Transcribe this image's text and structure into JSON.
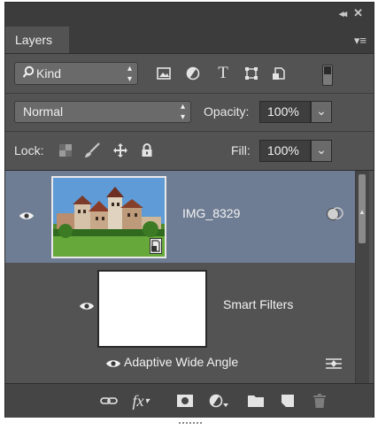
{
  "titlebar": {
    "collapse_glyph": "◂◂",
    "close_glyph": "✕"
  },
  "tab": {
    "label": "Layers"
  },
  "panel_menu_glyph": "▾≡",
  "filter": {
    "kind_label": "Kind",
    "search_glyph": "⚲",
    "buttons": [
      "pixel-layer-filter-icon",
      "adjustment-layer-filter-icon",
      "type-layer-filter-icon",
      "shape-layer-filter-icon",
      "smart-object-filter-icon"
    ],
    "type_glyph": "T"
  },
  "blend": {
    "mode": "Normal",
    "opacity_label": "Opacity:",
    "opacity_value": "100%"
  },
  "lock": {
    "label": "Lock:",
    "fill_label": "Fill:",
    "fill_value": "100%"
  },
  "layers": [
    {
      "name": "IMG_8329",
      "visible": true,
      "selected": true,
      "smart_filters": {
        "label": "Smart Filters",
        "filters": [
          {
            "name": "Adaptive Wide Angle"
          }
        ]
      }
    }
  ],
  "bottom_bar": {
    "fx_label": "fx",
    "buttons": [
      "link-layers-icon",
      "add-layer-style-icon",
      "add-layer-mask-icon",
      "new-adjustment-layer-icon",
      "new-group-icon",
      "new-layer-icon",
      "delete-layer-icon"
    ]
  },
  "colors": {
    "panel_bg": "#535353",
    "selected_layer": "#6f7d94",
    "title_bg": "#3c3c3c"
  }
}
